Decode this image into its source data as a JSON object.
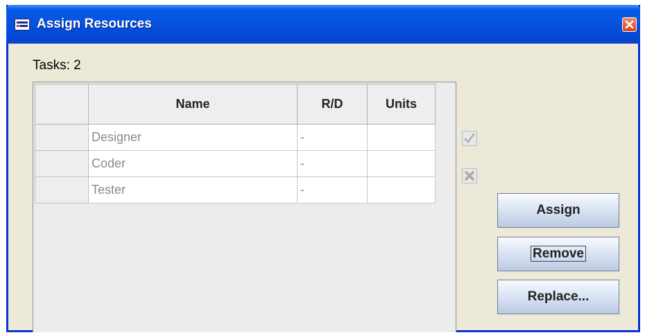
{
  "window": {
    "title": "Assign Resources",
    "icons": {
      "app": "app-icon",
      "close": "close-icon"
    }
  },
  "tasks_label": "Tasks: 2",
  "table": {
    "columns": [
      "",
      "Name",
      "R/D",
      "Units"
    ],
    "rows": [
      {
        "name": "Designer",
        "rd": "-",
        "units": ""
      },
      {
        "name": "Coder",
        "rd": "-",
        "units": ""
      },
      {
        "name": "Tester",
        "rd": "-",
        "units": ""
      }
    ]
  },
  "side_icons": [
    "checkmark-icon",
    "delete-x-icon"
  ],
  "buttons": {
    "assign": "Assign",
    "remove": "Remove",
    "replace": "Replace..."
  },
  "colors": {
    "titlebar": "#0553e0",
    "background": "#ece9d8",
    "close_button": "#d8421e"
  }
}
